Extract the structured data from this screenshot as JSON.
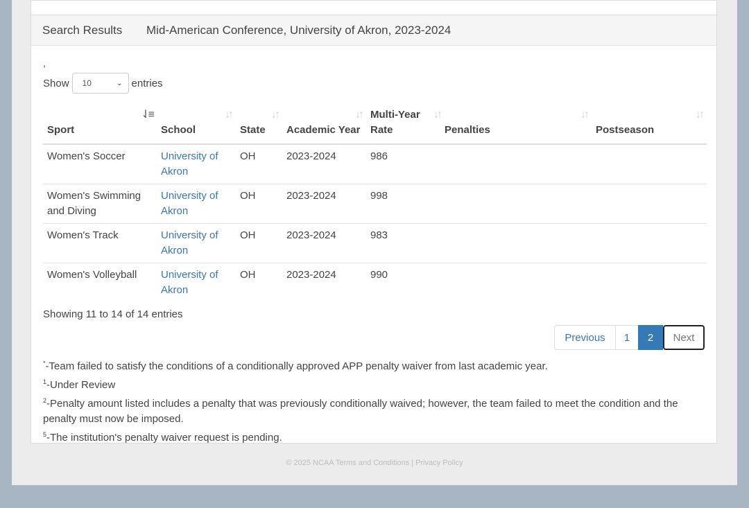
{
  "results_header": {
    "label": "Search Results",
    "title": "Mid-American Conference, University of Akron, 2023-2024"
  },
  "table_length": {
    "show": "Show",
    "entries": "entries",
    "selected": "10"
  },
  "columns": [
    "Sport",
    "School",
    "State",
    "Academic Year",
    "Multi-Year Rate",
    "Penalties",
    "Postseason"
  ],
  "rows": [
    {
      "sport": "Women's Soccer",
      "school": "University of Akron",
      "state": "OH",
      "year": "2023-2024",
      "rate": "986",
      "penalties": "",
      "postseason": ""
    },
    {
      "sport": "Women's Swimming and Diving",
      "school": "University of Akron",
      "state": "OH",
      "year": "2023-2024",
      "rate": "998",
      "penalties": "",
      "postseason": ""
    },
    {
      "sport": "Women's Track",
      "school": "University of Akron",
      "state": "OH",
      "year": "2023-2024",
      "rate": "983",
      "penalties": "",
      "postseason": ""
    },
    {
      "sport": "Women's Volleyball",
      "school": "University of Akron",
      "state": "OH",
      "year": "2023-2024",
      "rate": "990",
      "penalties": "",
      "postseason": ""
    }
  ],
  "info": "Showing 11 to 14 of 14 entries",
  "pagination": {
    "previous": "Previous",
    "page1": "1",
    "page2": "2",
    "next": "Next"
  },
  "notes": [
    {
      "mark": "*",
      "text": "-Team failed to satisfy the conditions of a conditionally approved APP penalty waiver from last academic year."
    },
    {
      "mark": "1",
      "text": "-Under Review"
    },
    {
      "mark": "2",
      "text": "-Penalty amount listed includes a penalty that was previously conditionally waived; however, the team failed to meet the condition and the penalty must now be imposed."
    },
    {
      "mark": "5",
      "text": "-The institution's penalty waiver request is pending."
    }
  ],
  "footer": "© 2025 NCAA Terms and Conditions | Privacy Policy"
}
